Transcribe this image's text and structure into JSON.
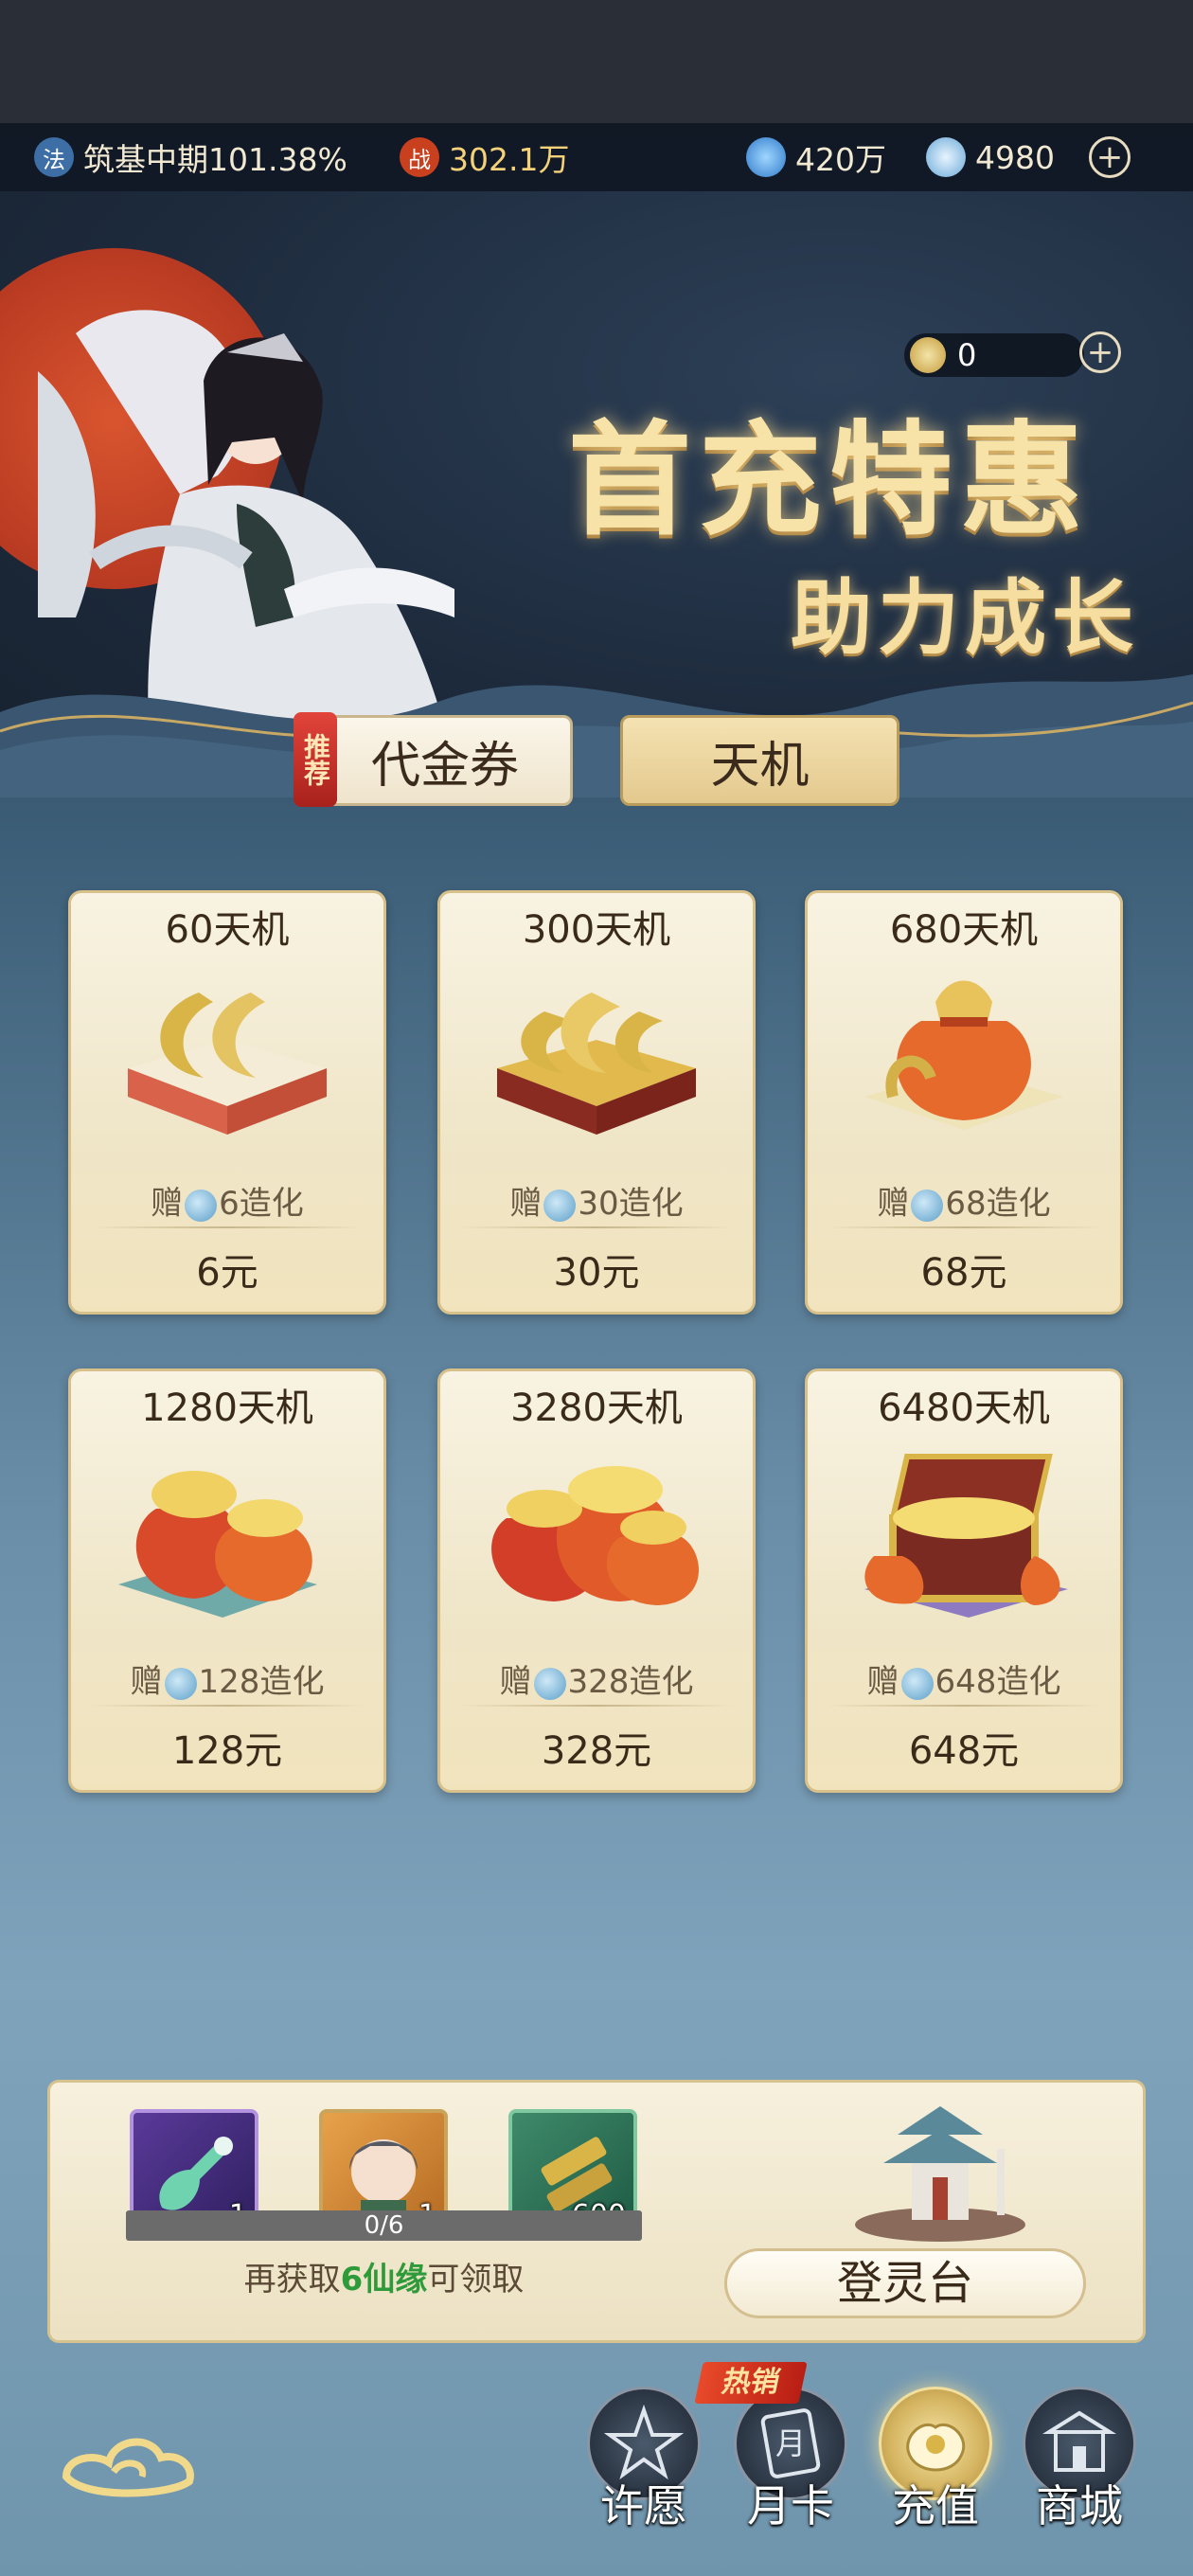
{
  "topbar": {
    "realm_icon": "法",
    "realm": "筑基中期101.38%",
    "power_icon": "战",
    "power": "302.1万",
    "spirit_stone": "420万",
    "zaohua": "4980"
  },
  "hero": {
    "title": "首充特惠",
    "subtitle": "助力成长",
    "currency_value": "0"
  },
  "tabs": {
    "recommend_badge": "推荐",
    "voucher": "代金券",
    "tianji": "天机"
  },
  "packs": [
    {
      "title": "60天机",
      "bonus_pre": "赠",
      "bonus": "6造化",
      "price": "6元"
    },
    {
      "title": "300天机",
      "bonus_pre": "赠",
      "bonus": "30造化",
      "price": "30元"
    },
    {
      "title": "680天机",
      "bonus_pre": "赠",
      "bonus": "68造化",
      "price": "68元"
    },
    {
      "title": "1280天机",
      "bonus_pre": "赠",
      "bonus": "128造化",
      "price": "128元"
    },
    {
      "title": "3280天机",
      "bonus_pre": "赠",
      "bonus": "328造化",
      "price": "328元"
    },
    {
      "title": "6480天机",
      "bonus_pre": "赠",
      "bonus": "648造化",
      "price": "648元"
    }
  ],
  "panel": {
    "rewards": [
      {
        "icon": "bottle-icon",
        "count": "1"
      },
      {
        "icon": "character-icon",
        "count": "1"
      },
      {
        "icon": "scroll-icon",
        "count": "600"
      }
    ],
    "progress_text": "0/6",
    "progress_fraction": 0,
    "hint_pre": "再获取",
    "hint_highlight": "6仙缘",
    "hint_post": "可领取",
    "dengling_label": "登灵台"
  },
  "nav": {
    "hot_badge": "热销",
    "items": [
      {
        "label": "许愿",
        "icon": "wish-icon"
      },
      {
        "label": "月卡",
        "icon": "month-card-icon"
      },
      {
        "label": "充值",
        "icon": "recharge-icon"
      },
      {
        "label": "商城",
        "icon": "shop-icon"
      }
    ]
  },
  "colors": {
    "accent_gold": "#f7e3a8",
    "highlight_green": "#2e9a3a",
    "badge_red": "#d8332a"
  }
}
